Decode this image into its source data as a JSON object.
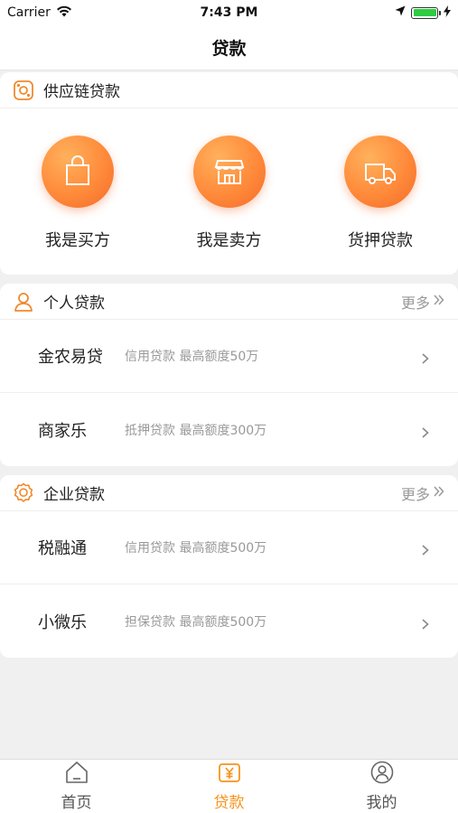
{
  "status_bar": {
    "carrier": "Carrier",
    "time": "7:43 PM"
  },
  "nav": {
    "title": "贷款"
  },
  "supply_chain": {
    "title": "供应链贷款",
    "items": [
      {
        "label": "我是买方",
        "icon": "shopping-bag-icon"
      },
      {
        "label": "我是卖方",
        "icon": "storefront-icon"
      },
      {
        "label": "货押贷款",
        "icon": "delivery-truck-icon"
      }
    ]
  },
  "personal": {
    "title": "个人贷款",
    "more": "更多",
    "rows": [
      {
        "name": "金农易贷",
        "desc": "信用贷款 最高额度50万"
      },
      {
        "name": "商家乐",
        "desc": "抵押贷款 最高额度300万"
      }
    ]
  },
  "enterprise": {
    "title": "企业贷款",
    "more": "更多",
    "rows": [
      {
        "name": "税融通",
        "desc": "信用贷款 最高额度500万"
      },
      {
        "name": "小微乐",
        "desc": "担保贷款 最高额度500万"
      }
    ]
  },
  "tabs": [
    {
      "label": "首页",
      "icon": "home-icon"
    },
    {
      "label": "贷款",
      "icon": "yen-icon",
      "active": true
    },
    {
      "label": "我的",
      "icon": "user-icon"
    }
  ],
  "colors": {
    "accent": "#f7931e",
    "icon_orange": "#f08a2e"
  }
}
